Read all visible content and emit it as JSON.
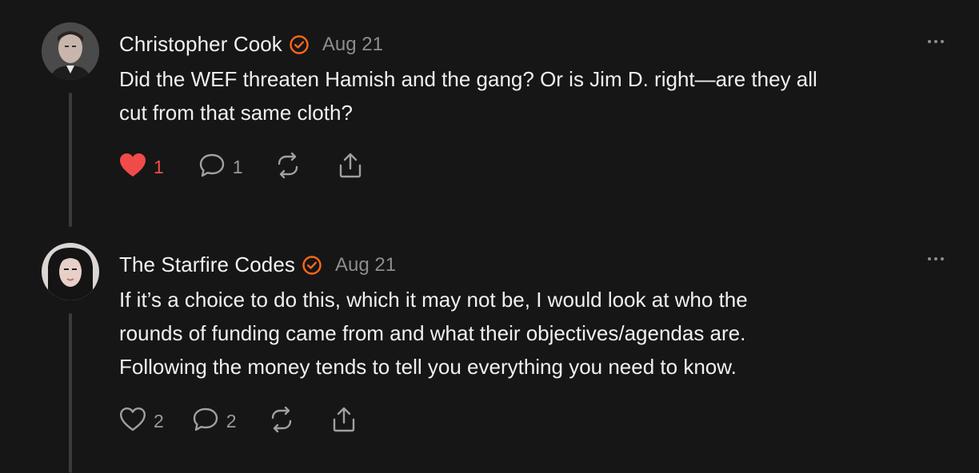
{
  "comments": [
    {
      "author": "Christopher Cook",
      "verified_icon": "verified-check-icon",
      "date": "Aug 21",
      "lines": [
        "Did the WEF threaten Hamish and the gang? Or is Jim D. right—are they all",
        "cut from that same cloth?"
      ],
      "likes": "1",
      "liked": true,
      "replies": "1"
    },
    {
      "author": "The Starfire Codes",
      "verified_icon": "verified-check-icon",
      "date": "Aug 21",
      "lines": [
        "If it’s a choice to do this, which it may not be, I would look at who the",
        "rounds of funding came from and what their objectives/agendas are.",
        "Following the money tends to tell you everything you need to know."
      ],
      "likes": "2",
      "liked": false,
      "replies": "2"
    }
  ],
  "colors": {
    "background": "#161616",
    "accent_orange": "#ff6719",
    "like_red": "#f04b4b",
    "muted": "#8d8d8d"
  }
}
